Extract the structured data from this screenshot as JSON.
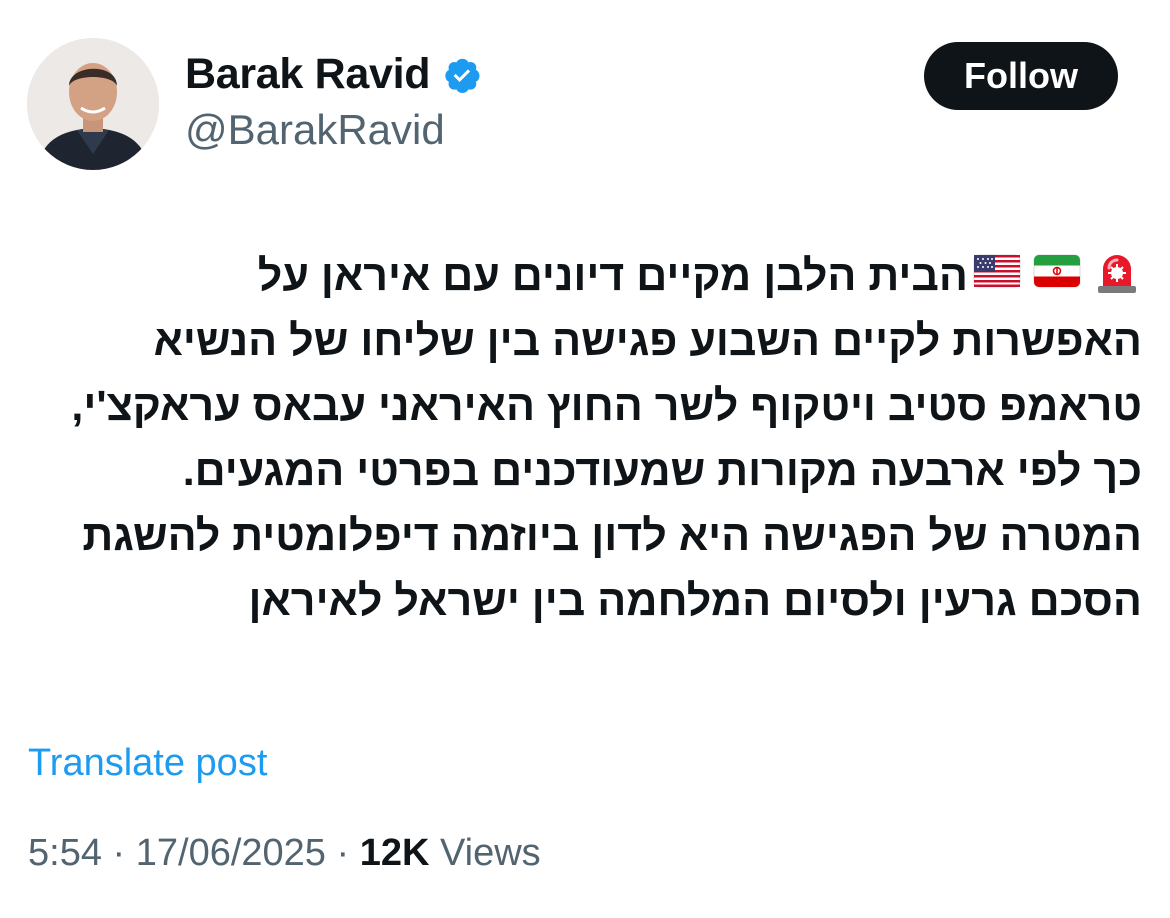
{
  "author": {
    "display_name": "Barak Ravid",
    "handle": "@BarakRavid",
    "verified": true
  },
  "follow_button_label": "Follow",
  "tweet": {
    "emojis": [
      "police-light-icon",
      "iran-flag-icon",
      "us-flag-icon"
    ],
    "lines": [
      "הבית הלבן מקיים דיונים עם איראן על",
      "האפשרות לקיים השבוע פגישה בין שליחו של הנשיא",
      "טראמפ סטיב ויטקוף לשר החוץ האיראני עבאס עראקצ'י,",
      "כך לפי ארבעה מקורות שמעודכנים בפרטי המגעים.",
      "המטרה של הפגישה היא לדון ביוזמה דיפלומטית להשגת",
      "הסכם גרעין ולסיום המלחמה בין ישראל לאיראן"
    ]
  },
  "translate_label": "Translate post",
  "meta": {
    "time": "5:54",
    "separator": " · ",
    "date": "17/06/2025",
    "views_count": "12K",
    "views_label": "Views"
  },
  "colors": {
    "text": "#0f1419",
    "secondary": "#536471",
    "link": "#1d9bf0",
    "button": "#0f1419"
  }
}
